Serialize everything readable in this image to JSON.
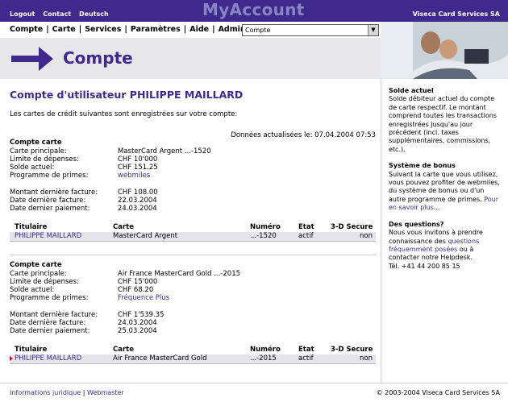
{
  "top": {
    "links": [
      "Logout",
      "Contact",
      "Deutsch"
    ],
    "brand": "MyAccount",
    "company": "Viseca Card Services SA"
  },
  "nav": {
    "items": [
      "Compte",
      "Carte",
      "Services",
      "Paramètres",
      "Aide",
      "Admin"
    ],
    "select_value": "Compte"
  },
  "hero": {
    "title": "Compte"
  },
  "main": {
    "title": "Compte d'utilisateur PHILIPPE MAILLARD",
    "intro": "Les cartes de crédit suivantes sont enregistrées sur votre compte:",
    "updated": "Données actualisées le: 07.04.2004 07:53",
    "cards": [
      {
        "block_title": "Compte carte",
        "fields": [
          {
            "k": "Carte principale:",
            "v": "MasterCard Argent ...-1520"
          },
          {
            "k": "Limite de dépenses:",
            "v": "CHF 10'000"
          },
          {
            "k": "Solde actuel:",
            "v": "CHF 151.25"
          },
          {
            "k": "Programme de primes:",
            "v": "webmiles"
          }
        ],
        "billing": [
          {
            "k": "Montant dernière facture:",
            "v": "CHF 108.00"
          },
          {
            "k": "Date dernière facture:",
            "v": "22.03.2004"
          },
          {
            "k": "Date dernier paiement:",
            "v": "24.03.2004"
          }
        ],
        "table_row": {
          "titulaire": "PHILIPPE MAILLARD",
          "carte": "MasterCard Argent",
          "numero": "...-1520",
          "etat": "actif",
          "secure": "non"
        }
      },
      {
        "block_title": "Compte carte",
        "fields": [
          {
            "k": "Carte principale:",
            "v": "Air France MasterCard Gold ...-2015"
          },
          {
            "k": "Limite de dépenses:",
            "v": "CHF 15'000"
          },
          {
            "k": "Solde actuel:",
            "v": "CHF 68.20"
          },
          {
            "k": "Programme de primes:",
            "v": "Fréquence Plus"
          }
        ],
        "billing": [
          {
            "k": "Montant dernière facture:",
            "v": "CHF 1'539.35"
          },
          {
            "k": "Date dernière facture:",
            "v": "24.03.2004"
          },
          {
            "k": "Date dernier paiement:",
            "v": "25.03.2004"
          }
        ],
        "table_row": {
          "titulaire": "PHILIPPE MAILLARD",
          "carte": "Air France MasterCard Gold",
          "numero": "...-2015",
          "etat": "actif",
          "secure": "non"
        }
      }
    ],
    "table_headers": {
      "titulaire": "Titulaire",
      "carte": "Carte",
      "numero": "Numéro",
      "etat": "Etat",
      "secure": "3-D Secure"
    }
  },
  "side": {
    "solde_title": "Solde actuel",
    "solde_text": "Solde débiteur actuel du compte de carte respectif. Le montant comprend toutes les transactions enregistrées jusqu'au jour précédent (incl. taxes supplémentaires, commissions, etc.).",
    "bonus_title": "Système de bonus",
    "bonus_text": "Suivant la carte que vous utilisez, vous pouvez profiter de webmiles, du système de bonus ou d'un autre programme de primes.",
    "bonus_link": "Pour en savoir plus...",
    "questions_title": "Des questions?",
    "questions_text1": "Nous vous invitons à prendre connaissance des",
    "questions_link": "questions fréquemment posées",
    "questions_text2": "ou à contacter notre Helpdesk.",
    "phone": "Tél. +41 44 200 85 15"
  },
  "footer": {
    "legal": "Informations juridique",
    "webmaster": "Webmaster",
    "copyright": "© 2003-2004 Viseca Card Services SA"
  },
  "colors": {
    "brand_purple": "#3d2a8c",
    "hero_bg": "#e7e7ea",
    "row_bg": "#e4e4ea"
  }
}
